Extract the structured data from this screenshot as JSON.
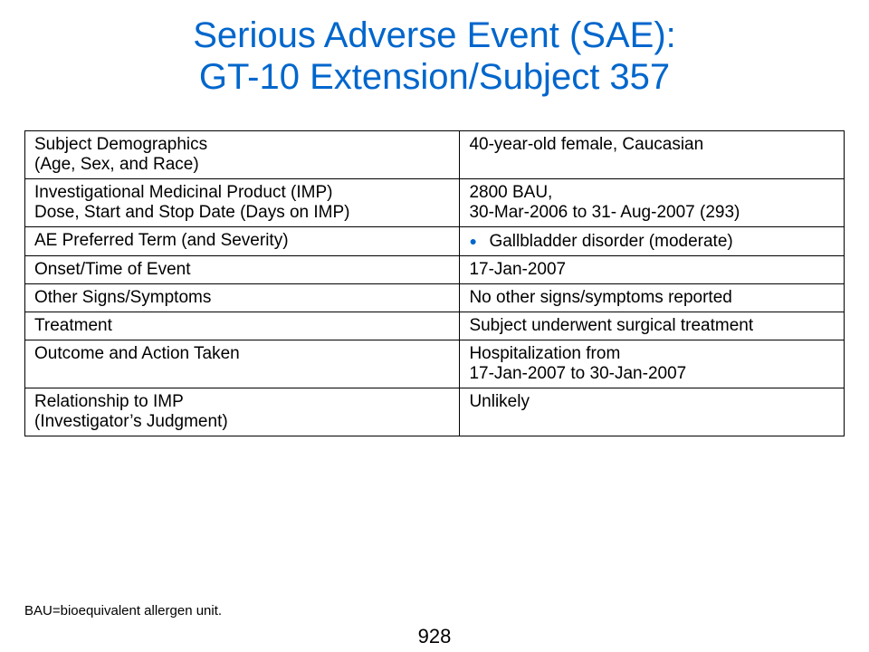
{
  "title": {
    "line1": "Serious Adverse Event (SAE):",
    "line2": "GT-10 Extension/Subject 357"
  },
  "colors": {
    "title": "#0066CC",
    "bullet": "#0066CC",
    "border": "#000000"
  },
  "table": {
    "rows": [
      {
        "label_lines": [
          "Subject Demographics",
          "(Age, Sex, and Race)"
        ],
        "value_lines": [
          "40-year-old female, Caucasian"
        ]
      },
      {
        "label_lines": [
          "Investigational Medicinal Product (IMP)",
          "Dose, Start and Stop Date (Days on IMP)"
        ],
        "value_lines": [
          "2800 BAU,",
          "30-Mar-2006  to 31- Aug-2007 (293)"
        ]
      },
      {
        "label_lines": [
          "AE Preferred Term (and Severity)"
        ],
        "value_lines": [
          "Gallbladder disorder (moderate)"
        ],
        "bullet_icon": "bullet-dot-icon",
        "bullet": "●"
      },
      {
        "label_lines": [
          "Onset/Time of Event"
        ],
        "value_lines": [
          "17-Jan-2007"
        ]
      },
      {
        "label_lines": [
          "Other Signs/Symptoms"
        ],
        "value_lines": [
          "No other signs/symptoms reported"
        ]
      },
      {
        "label_lines": [
          "Treatment"
        ],
        "value_lines": [
          "Subject underwent surgical treatment"
        ]
      },
      {
        "label_lines": [
          "Outcome and Action Taken"
        ],
        "value_lines": [
          "Hospitalization from",
          "17-Jan-2007 to 30-Jan-2007"
        ]
      },
      {
        "label_lines": [
          "Relationship to IMP",
          "(Investigator’s Judgment)"
        ],
        "value_lines": [
          "Unlikely"
        ]
      }
    ]
  },
  "footnote": "BAU=bioequivalent allergen unit.",
  "page_number": "928"
}
